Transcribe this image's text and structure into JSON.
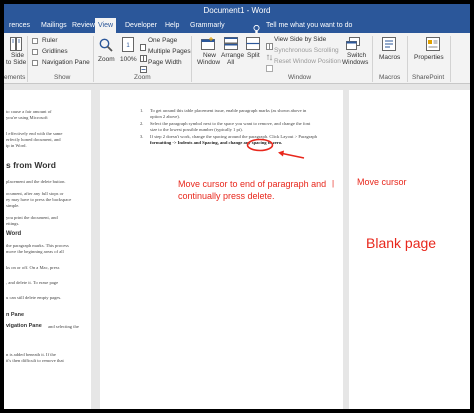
{
  "window": {
    "title": "Document1 - Word"
  },
  "tabs": [
    {
      "label": "rences"
    },
    {
      "label": "Mailings"
    },
    {
      "label": "Review"
    },
    {
      "label": "View"
    },
    {
      "label": "Developer"
    },
    {
      "label": "Help"
    },
    {
      "label": "Grammarly"
    }
  ],
  "tell_me": "Tell me what you want to do",
  "ribbon": {
    "side_to_side_1": "Side",
    "side_to_side_2": "to Side",
    "ruler": "Ruler",
    "gridlines": "Gridlines",
    "navigation_pane": "Navigation Pane",
    "zoom": "Zoom",
    "hundred": "100%",
    "one_page": "One Page",
    "multiple_pages": "Multiple Pages",
    "page_width": "Page Width",
    "new_window_1": "New",
    "new_window_2": "Window",
    "arrange_all_1": "Arrange",
    "arrange_all_2": "All",
    "split": "Split",
    "view_side_by_side": "View Side by Side",
    "synchronous_scrolling": "Synchronous Scrolling",
    "reset_window_position": "Reset Window Position",
    "switch_windows_1": "Switch",
    "switch_windows_2": "Windows",
    "macros": "Macros",
    "properties": "Properties",
    "groups": {
      "immersive": "ements",
      "show": "Show",
      "zoom": "Zoom",
      "window": "Window",
      "macros": "Macros",
      "sharepoint": "SharePoint"
    }
  },
  "left_page": {
    "lines": [
      "to cause a fair amount of",
      "you're using Microsoft",
      "l effectively end with the same",
      "erfectly honed document, and",
      "ip in Word."
    ],
    "heading": "s from Word",
    "lines2": [
      "placement and the delete button.",
      "ocument, after any full stops or",
      "ey may have to press the backspace",
      "simple.",
      "you print the document, and",
      "ettings."
    ],
    "subheading": "Word",
    "lines3": [
      "the paragraph marks. This process",
      "move the beginning areas of all",
      "ks on or off. On a Mac, press",
      ", and delete it. To erase page",
      "u can still delete empty pages."
    ],
    "subheading2": "n Pane",
    "subheading3": "vigation Pane",
    "lines4": [
      "and selecting the",
      "n is added beneath it. If the",
      "it's then difficult to remove that"
    ]
  },
  "middle_page": {
    "items": [
      {
        "num": "1.",
        "lines": [
          "To get around this table placement issue, enable paragraph marks (as shown above in",
          "option 2 above)."
        ]
      },
      {
        "num": "2.",
        "lines": [
          "Select the paragraph symbol next to the space you want to remove, and change the font",
          "size to the lowest possible number (typically 1 pt)."
        ]
      },
      {
        "num": "3.",
        "lines": [
          "If step 2 doesn't work, change the spacing around the paragraph. Click Layout > Paragraph",
          "formatting -> Indents and Spacing, and change any spacing to zero."
        ]
      }
    ]
  },
  "annotations": {
    "cursor_instruction_1": "Move cursor to end of paragraph and",
    "cursor_instruction_2": "continually press delete.",
    "cursor_marker": "|",
    "move_cursor": "Move cursor",
    "blank_page": "Blank page",
    "color": "#e8271c"
  }
}
